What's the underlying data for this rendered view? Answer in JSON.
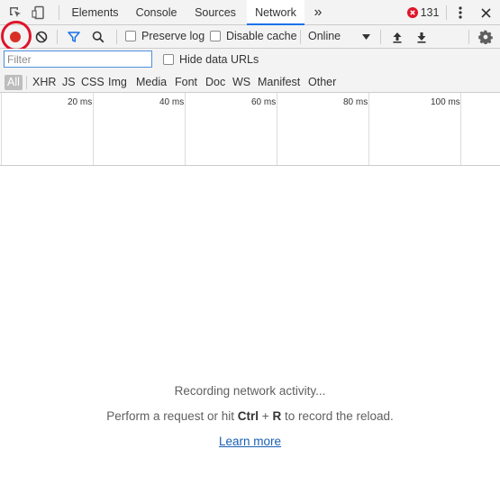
{
  "tabs": [
    {
      "label": "Elements",
      "active": false
    },
    {
      "label": "Console",
      "active": false
    },
    {
      "label": "Sources",
      "active": false
    },
    {
      "label": "Network",
      "active": true
    }
  ],
  "more_tabs_glyph": "»",
  "error_count": "131",
  "toolbar": {
    "preserve_log_label": "Preserve log",
    "disable_cache_label": "Disable cache",
    "throttling_value": "Online"
  },
  "filter": {
    "placeholder": "Filter",
    "hide_data_urls_label": "Hide data URLs"
  },
  "resource_types": [
    "All",
    "XHR",
    "JS",
    "CSS",
    "Img",
    "Media",
    "Font",
    "Doc",
    "WS",
    "Manifest",
    "Other"
  ],
  "timeline_ticks": [
    "20 ms",
    "40 ms",
    "60 ms",
    "80 ms",
    "100 ms"
  ],
  "empty_state": {
    "line1": "Recording network activity...",
    "line2_before": "Perform a request or hit ",
    "line2_key1": "Ctrl",
    "line2_plus": " + ",
    "line2_key2": "R",
    "line2_after": " to record the reload.",
    "learn_more": "Learn more"
  },
  "colors": {
    "record": "#d93025",
    "highlight_ring": "#e0142a",
    "accent": "#1a73e8",
    "error": "#e0142a"
  }
}
